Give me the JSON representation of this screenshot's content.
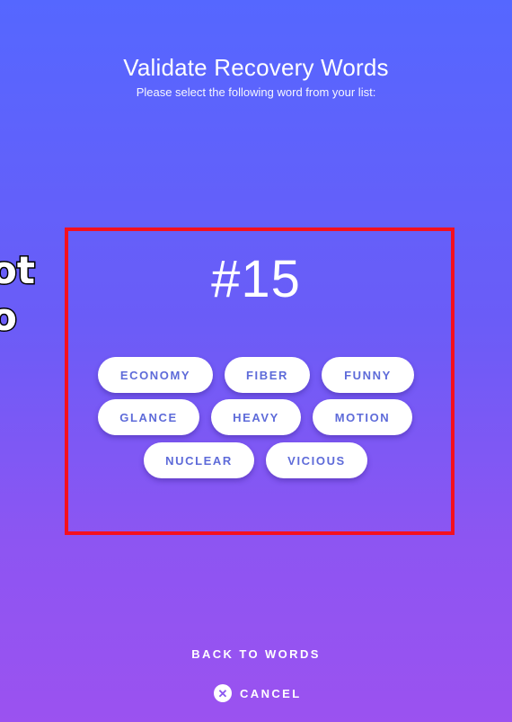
{
  "header": {
    "title": "Validate Recovery Words",
    "subtitle": "Please select the following word from your list:"
  },
  "overlay_text": {
    "line1": "ot",
    "line2": "o"
  },
  "challenge": {
    "number": "#15"
  },
  "word_options": [
    "ECONOMY",
    "FIBER",
    "FUNNY",
    "GLANCE",
    "HEAVY",
    "MOTION",
    "NUCLEAR",
    "VICIOUS"
  ],
  "footer": {
    "back_label": "BACK TO WORDS",
    "cancel_label": "CANCEL",
    "cancel_icon": "close-icon"
  },
  "colors": {
    "highlight_border": "#f4101e",
    "pill_text": "#5e6bd9",
    "gradient_top": "#5567ff",
    "gradient_bottom": "#9b52f0"
  }
}
